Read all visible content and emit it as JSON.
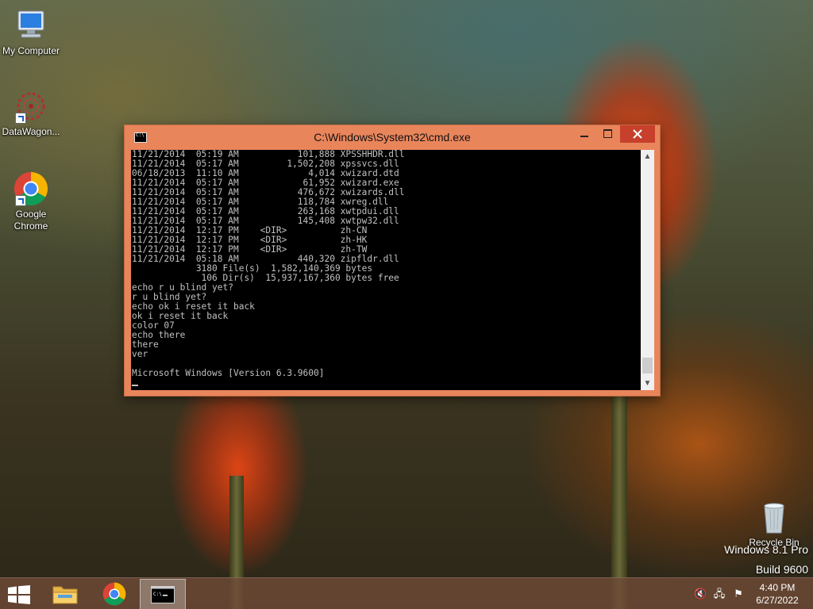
{
  "desktop": {
    "icons": [
      {
        "label": "My Computer"
      },
      {
        "label": "DataWagon..."
      },
      {
        "label": "Google Chrome"
      },
      {
        "label": "Recycle Bin"
      }
    ],
    "watermark": {
      "line1": "Windows 8.1 Pro",
      "line2": "Build 9600"
    }
  },
  "cmd_window": {
    "title": "C:\\Windows\\System32\\cmd.exe",
    "lines": [
      "11/21/2014  05:19 AM           101,888 XPSSHHDR.dll",
      "11/21/2014  05:17 AM         1,502,208 xpssvcs.dll",
      "06/18/2013  11:10 AM             4,014 xwizard.dtd",
      "11/21/2014  05:17 AM            61,952 xwizard.exe",
      "11/21/2014  05:17 AM           476,672 xwizards.dll",
      "11/21/2014  05:17 AM           118,784 xwreg.dll",
      "11/21/2014  05:17 AM           263,168 xwtpdui.dll",
      "11/21/2014  05:17 AM           145,408 xwtpw32.dll",
      "11/21/2014  12:17 PM    <DIR>          zh-CN",
      "11/21/2014  12:17 PM    <DIR>          zh-HK",
      "11/21/2014  12:17 PM    <DIR>          zh-TW",
      "11/21/2014  05:18 AM           440,320 zipfldr.dll",
      "            3180 File(s)  1,582,140,369 bytes",
      "             106 Dir(s)  15,937,167,360 bytes free",
      "echo r u blind yet?",
      "r u blind yet?",
      "echo ok i reset it back",
      "ok i reset it back",
      "color 07",
      "echo there",
      "there",
      "ver",
      "",
      "Microsoft Windows [Version 6.3.9600]"
    ],
    "scroll_up_glyph": "▲",
    "scroll_down_glyph": "▼"
  },
  "taskbar": {
    "items": [
      {
        "name": "file-explorer",
        "icon": "folder-icon"
      },
      {
        "name": "google-chrome",
        "icon": "chrome-icon"
      },
      {
        "name": "command-prompt",
        "icon": "cmd-icon"
      }
    ],
    "tray": {
      "time": "4:40 PM",
      "date": "6/27/2022",
      "volume_glyph": "🔇",
      "network_glyph": "🖧",
      "flag_glyph": "⚑"
    }
  }
}
